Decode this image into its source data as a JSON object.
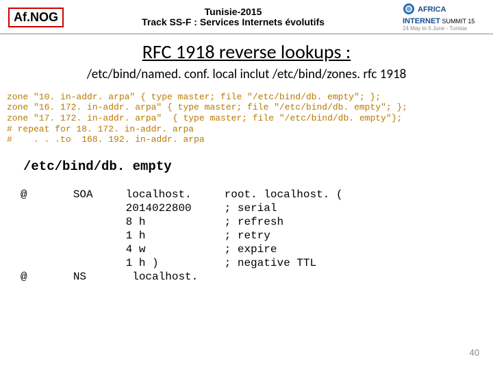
{
  "header": {
    "afnog": "Af.NOG",
    "line1": "Tunisie-2015",
    "line2": "Track SS-F : Services Internets évolutifs",
    "summit_big": "AFRICA",
    "summit_mid": "INTERNET",
    "summit_small": "SUMMIT 15",
    "summit_sub": "24 May to 5 June - Tunisia"
  },
  "title": "RFC 1918 reverse lookups :",
  "subtitle": "/etc/bind/named. conf. local inclut  /etc/bind/zones. rfc 1918",
  "zone_block": "zone \"10. in-addr. arpa\" { type master; file \"/etc/bind/db. empty\"; };\nzone \"16. 172. in-addr. arpa\" { type master; file \"/etc/bind/db. empty\"; };\nzone \"17. 172. in-addr. arpa\"  { type master; file \"/etc/bind/db. empty\"};\n# repeat for 18. 172. in-addr. arpa\n#    . . .to  168. 192. in-addr. arpa",
  "file_label": "/etc/bind/db. empty",
  "db_block": "@       SOA     localhost.     root. localhost. (\n                2014022800     ; serial\n                8 h            ; refresh\n                1 h            ; retry\n                4 w            ; expire\n                1 h )          ; negative TTL\n@       NS       localhost.",
  "page": "40"
}
